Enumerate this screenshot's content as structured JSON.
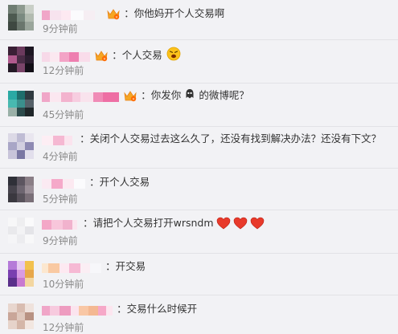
{
  "comments": [
    {
      "text": "：你他妈开个人交易啊",
      "time": "9分钟前"
    },
    {
      "text": "：个人交易",
      "time": "12分钟前"
    },
    {
      "text": "：你发你",
      "text2": "的微博呢？",
      "time": "45分钟前"
    },
    {
      "text": "：关闭个人交易过去这么久了，还没有找到解决办法？还没有下文？",
      "time": "4分钟前"
    },
    {
      "text": "：开个人交易",
      "time": "5分钟前"
    },
    {
      "text": "：请把个人交易打开wrsndm",
      "time": "9分钟前"
    },
    {
      "text": "：开交易",
      "time": "10分钟前"
    },
    {
      "text": "：交易什么时候开",
      "time": "12分钟前"
    }
  ],
  "colors": {
    "background": "#f2f2f5",
    "text": "#333333",
    "time": "#8a8a8a",
    "divider": "#e2e2e6",
    "heart": "#e83a2b"
  },
  "icons": [
    "avatar",
    "vip-badge-icon",
    "angry-face-emoji-icon",
    "ghost-emoji-icon",
    "heart-icon"
  ]
}
